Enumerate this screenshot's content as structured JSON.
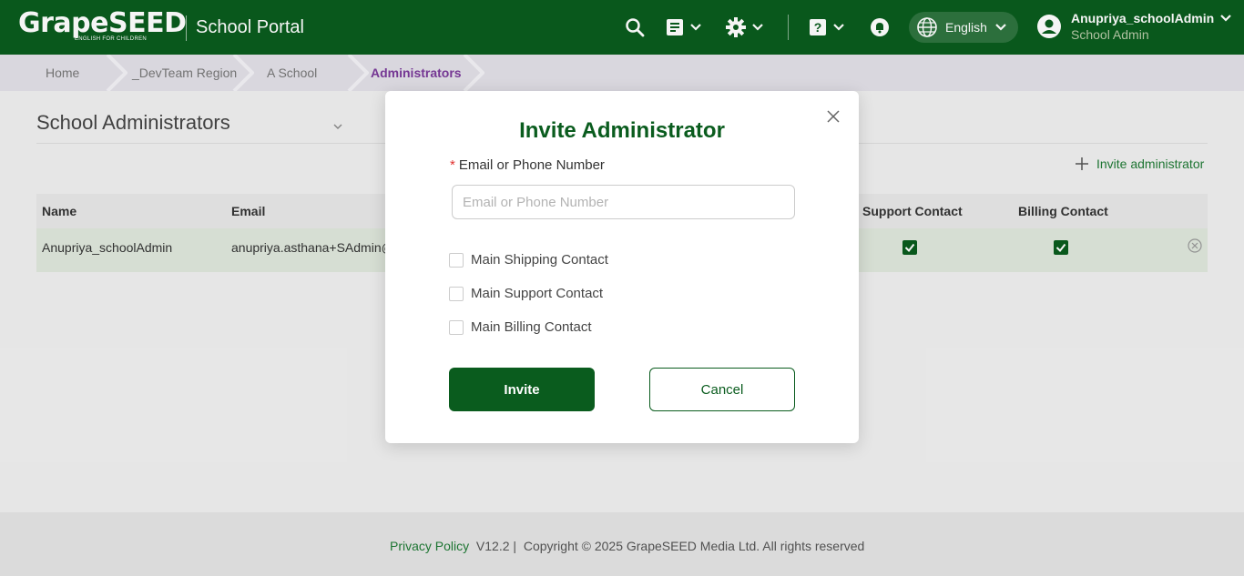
{
  "header": {
    "logo_text": "GrapeSEED",
    "logo_tagline": "ENGLISH FOR CHILDREN",
    "portal_title": "School Portal",
    "language": "English",
    "user_name": "Anupriya_schoolAdmin",
    "user_role": "School Admin",
    "brand_color": "#0a5c1e"
  },
  "breadcrumb": {
    "home": "Home",
    "region": "_DevTeam Region",
    "school": "A School",
    "current": "Administrators"
  },
  "main": {
    "page_title": "School Administrators",
    "invite_link": "Invite administrator",
    "table": {
      "columns": [
        "Name",
        "Email",
        "Support Contact",
        "Billing Contact"
      ],
      "rows": [
        {
          "name": "Anupriya_schoolAdmin",
          "email": "anupriya.asthana+SAdmin@",
          "support": true,
          "billing": true
        }
      ]
    }
  },
  "modal": {
    "title": "Invite Administrator",
    "field_required_mark": "*",
    "field_label": "Email or Phone Number",
    "field_placeholder": "Email or Phone Number",
    "field_value": "",
    "checkboxes": [
      {
        "label": "Main Shipping Contact",
        "checked": false
      },
      {
        "label": "Main Support Contact",
        "checked": false
      },
      {
        "label": "Main Billing Contact",
        "checked": false
      }
    ],
    "invite_label": "Invite",
    "cancel_label": "Cancel"
  },
  "footer": {
    "privacy": "Privacy Policy",
    "version": "V12.2 |",
    "copyright": "Copyright © 2025 GrapeSEED Media Ltd. All rights reserved"
  }
}
